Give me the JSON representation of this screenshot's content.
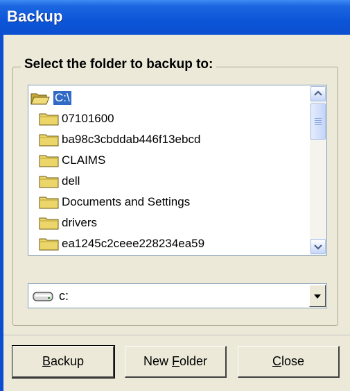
{
  "window": {
    "title": "Backup"
  },
  "group": {
    "label": "Select the folder to backup to:"
  },
  "folders": [
    {
      "label": "C:\\",
      "icon": "open-folder-icon"
    },
    {
      "label": "07101600",
      "icon": "folder-icon"
    },
    {
      "label": "ba98c3cbddab446f13ebcd",
      "icon": "folder-icon"
    },
    {
      "label": "CLAIMS",
      "icon": "folder-icon"
    },
    {
      "label": "dell",
      "icon": "folder-icon"
    },
    {
      "label": "Documents and Settings",
      "icon": "folder-icon"
    },
    {
      "label": "drivers",
      "icon": "folder-icon"
    },
    {
      "label": "ea1245c2ceee228234ea59",
      "icon": "folder-icon"
    }
  ],
  "drive": {
    "value": "c:",
    "icon": "drive-icon"
  },
  "buttons": {
    "backup": {
      "key": "B",
      "rest": "ackup"
    },
    "new_folder": {
      "pre": "New ",
      "key": "F",
      "rest": "older"
    },
    "close": {
      "key": "C",
      "rest": "lose"
    }
  },
  "colors": {
    "title_bar": "#0a4fcf",
    "selection": "#316ac5",
    "dialog": "#ece9d8"
  }
}
